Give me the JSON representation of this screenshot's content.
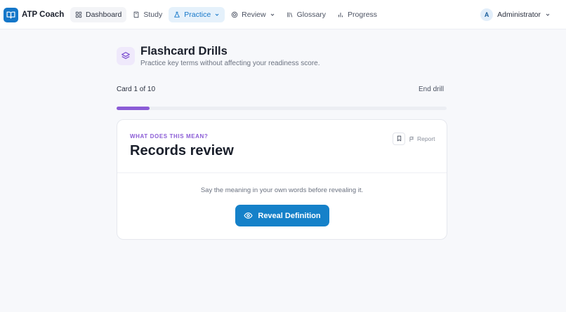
{
  "app": {
    "name": "ATP Coach"
  },
  "nav": {
    "items": [
      {
        "label": "Dashboard",
        "icon": "dashboard-icon"
      },
      {
        "label": "Study",
        "icon": "book-icon"
      },
      {
        "label": "Practice",
        "icon": "flask-icon",
        "active": true,
        "dropdown": true
      },
      {
        "label": "Review",
        "icon": "target-icon",
        "dropdown": true
      },
      {
        "label": "Glossary",
        "icon": "library-icon"
      },
      {
        "label": "Progress",
        "icon": "bar-chart-icon"
      }
    ]
  },
  "user": {
    "initial": "A",
    "name": "Administrator"
  },
  "header": {
    "title": "Flashcard Drills",
    "subtitle": "Practice key terms without affecting your readiness score."
  },
  "progress": {
    "label": "Card 1 of 10",
    "current": 1,
    "total": 10,
    "end_label": "End drill"
  },
  "card": {
    "eyebrow": "WHAT DOES THIS MEAN?",
    "term": "Records review",
    "report_label": "Report",
    "hint": "Say the meaning in your own words before revealing it.",
    "reveal_label": "Reveal Definition"
  },
  "colors": {
    "accent": "#1577c9",
    "purple": "#8b5cd6",
    "background": "#f7f8fb"
  }
}
